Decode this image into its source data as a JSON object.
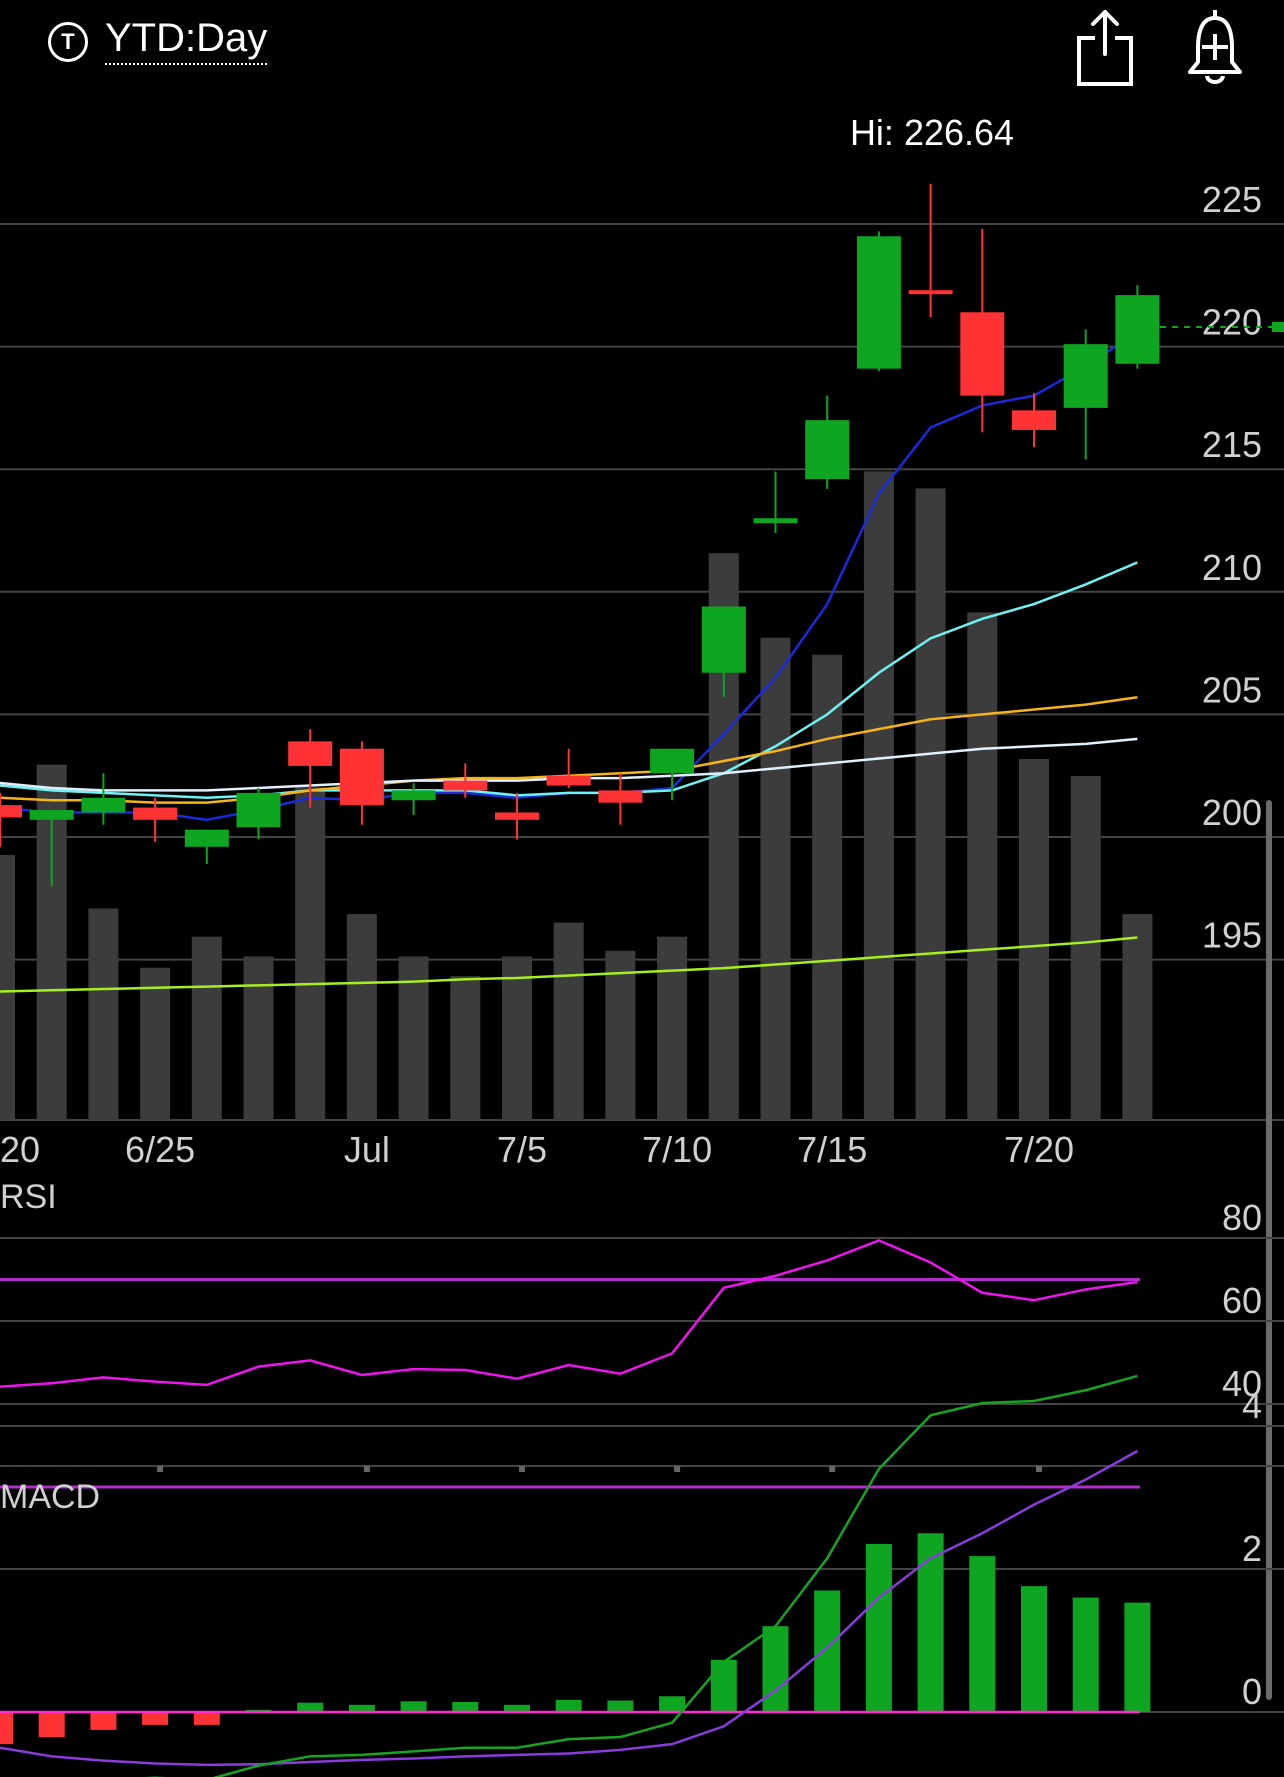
{
  "header": {
    "ticker_icon_letter": "T",
    "range_label": "YTD:Day",
    "share_icon": "share-icon",
    "alert_icon": "bell-plus-icon"
  },
  "chart_data": [
    {
      "type": "candlestick",
      "title": "",
      "annotation": "Hi: 226.64",
      "y_ticks": [
        225,
        220,
        215,
        210,
        205,
        200,
        195
      ],
      "x_ticks": [
        "20",
        "6/25",
        "Jul",
        "7/5",
        "7/10",
        "7/15",
        "7/20"
      ],
      "last_price": 220.8,
      "candles": [
        {
          "o": 201.3,
          "h": 201.8,
          "l": 199.6,
          "c": 200.8,
          "dir": "down"
        },
        {
          "o": 200.7,
          "h": 201.0,
          "l": 198.0,
          "c": 201.1,
          "dir": "up"
        },
        {
          "o": 201.0,
          "h": 202.6,
          "l": 200.5,
          "c": 201.6,
          "dir": "up"
        },
        {
          "o": 201.2,
          "h": 201.6,
          "l": 199.8,
          "c": 200.7,
          "dir": "down"
        },
        {
          "o": 199.6,
          "h": 200.2,
          "l": 198.9,
          "c": 200.3,
          "dir": "up"
        },
        {
          "o": 200.4,
          "h": 202.0,
          "l": 199.9,
          "c": 201.8,
          "dir": "up"
        },
        {
          "o": 203.9,
          "h": 204.4,
          "l": 201.2,
          "c": 202.9,
          "dir": "down"
        },
        {
          "o": 203.6,
          "h": 203.9,
          "l": 200.5,
          "c": 201.3,
          "dir": "down"
        },
        {
          "o": 201.5,
          "h": 202.2,
          "l": 200.9,
          "c": 201.9,
          "dir": "up"
        },
        {
          "o": 202.3,
          "h": 203.0,
          "l": 201.6,
          "c": 201.9,
          "dir": "down"
        },
        {
          "o": 201.0,
          "h": 201.8,
          "l": 199.9,
          "c": 200.7,
          "dir": "down"
        },
        {
          "o": 202.5,
          "h": 203.6,
          "l": 202.0,
          "c": 202.1,
          "dir": "down"
        },
        {
          "o": 201.9,
          "h": 202.6,
          "l": 200.5,
          "c": 201.4,
          "dir": "down"
        },
        {
          "o": 202.6,
          "h": 203.5,
          "l": 201.5,
          "c": 203.6,
          "dir": "up"
        },
        {
          "o": 206.7,
          "h": 208.2,
          "l": 205.7,
          "c": 209.4,
          "dir": "up"
        },
        {
          "o": 212.8,
          "h": 214.9,
          "l": 212.4,
          "c": 213.0,
          "dir": "up"
        },
        {
          "o": 214.6,
          "h": 218.0,
          "l": 214.2,
          "c": 217.0,
          "dir": "up"
        },
        {
          "o": 219.1,
          "h": 224.7,
          "l": 219.0,
          "c": 224.5,
          "dir": "up"
        },
        {
          "o": 222.3,
          "h": 226.64,
          "l": 221.2,
          "c": 222.2,
          "dir": "down"
        },
        {
          "o": 221.4,
          "h": 224.8,
          "l": 216.5,
          "c": 218.0,
          "dir": "down"
        },
        {
          "o": 217.4,
          "h": 218.1,
          "l": 215.9,
          "c": 216.6,
          "dir": "down"
        },
        {
          "o": 217.5,
          "h": 220.7,
          "l": 215.4,
          "c": 220.1,
          "dir": "up"
        },
        {
          "o": 219.3,
          "h": 222.5,
          "l": 219.1,
          "c": 222.1,
          "dir": "up"
        }
      ],
      "volume_relative": [
        0.94,
        1.26,
        0.75,
        0.54,
        0.65,
        0.58,
        1.18,
        0.73,
        0.58,
        0.51,
        0.58,
        0.7,
        0.6,
        0.65,
        2.01,
        1.71,
        1.65,
        2.3,
        2.24,
        1.8,
        1.28,
        1.22,
        0.73
      ],
      "moving_averages": [
        {
          "color": "#1a2bdb",
          "values": [
            201.2,
            201.0,
            201.0,
            201.0,
            200.7,
            201.1,
            201.6,
            201.5,
            201.8,
            201.8,
            201.6,
            201.8,
            201.8,
            202.0,
            204.2,
            206.5,
            209.5,
            214.0,
            216.7,
            217.6,
            218.0,
            219.2,
            220.6
          ]
        },
        {
          "color": "#6ef2f2",
          "values": [
            202.1,
            201.9,
            201.8,
            201.7,
            201.6,
            201.7,
            201.9,
            201.9,
            201.9,
            201.9,
            201.7,
            201.8,
            201.8,
            201.9,
            202.6,
            203.7,
            205.0,
            206.7,
            208.1,
            208.9,
            209.5,
            210.3,
            211.2
          ]
        },
        {
          "color": "#f5b41a",
          "values": [
            201.6,
            201.5,
            201.5,
            201.4,
            201.4,
            201.6,
            201.9,
            202.1,
            202.3,
            202.4,
            202.4,
            202.5,
            202.6,
            202.7,
            203.1,
            203.5,
            204.0,
            204.4,
            204.8,
            205.0,
            205.2,
            205.4,
            205.7
          ]
        },
        {
          "color": "#e0f0ff",
          "values": [
            202.2,
            202.0,
            201.9,
            201.9,
            201.9,
            202.0,
            202.1,
            202.2,
            202.3,
            202.3,
            202.3,
            202.4,
            202.4,
            202.5,
            202.6,
            202.8,
            203.0,
            203.2,
            203.4,
            203.6,
            203.7,
            203.8,
            204.0
          ]
        },
        {
          "color": "#a6ef1c",
          "values": [
            193.7,
            193.75,
            193.8,
            193.85,
            193.9,
            193.95,
            194.0,
            194.05,
            194.1,
            194.2,
            194.25,
            194.35,
            194.45,
            194.55,
            194.65,
            194.8,
            194.95,
            195.1,
            195.25,
            195.4,
            195.55,
            195.7,
            195.9
          ]
        }
      ]
    },
    {
      "type": "line",
      "title": "RSI",
      "y_ticks": [
        80,
        60,
        40
      ],
      "reference_lines": [
        70,
        20
      ],
      "values": [
        44.2,
        45.0,
        46.4,
        45.4,
        44.6,
        49.0,
        50.5,
        47.0,
        48.4,
        48.2,
        46.1,
        49.4,
        47.3,
        52.2,
        68.0,
        70.9,
        74.6,
        79.4,
        74.1,
        66.8,
        65.0,
        67.6,
        69.4
      ]
    },
    {
      "type": "bar+line",
      "title": "MACD",
      "y_ticks": [
        4,
        2,
        0
      ],
      "histogram": [
        -0.45,
        -0.35,
        -0.25,
        -0.18,
        -0.18,
        0.03,
        0.13,
        0.1,
        0.15,
        0.14,
        0.1,
        0.17,
        0.16,
        0.22,
        0.73,
        1.2,
        1.7,
        2.35,
        2.5,
        2.18,
        1.76,
        1.6,
        1.53
      ],
      "macd": [
        -0.95,
        -0.98,
        -0.95,
        -0.92,
        -0.95,
        -0.75,
        -0.62,
        -0.6,
        -0.55,
        -0.5,
        -0.5,
        -0.38,
        -0.35,
        -0.15,
        0.7,
        1.2,
        2.15,
        3.4,
        4.15,
        4.32,
        4.35,
        4.5,
        4.7
      ],
      "signal": [
        -0.5,
        -0.62,
        -0.68,
        -0.72,
        -0.74,
        -0.73,
        -0.7,
        -0.67,
        -0.65,
        -0.62,
        -0.6,
        -0.58,
        -0.53,
        -0.45,
        -0.2,
        0.3,
        0.9,
        1.6,
        2.15,
        2.5,
        2.9,
        3.25,
        3.65
      ]
    }
  ],
  "colors": {
    "up": "#0ea520",
    "down": "#ff3333",
    "grid": "#444444",
    "volume": "#3c3c3c",
    "rsi_line": "#ee14ee",
    "rsi_ref": "#b12dcc",
    "macd_line": "#16a421",
    "signal_line": "#8a3bdc",
    "macd_zero": "#ff2dd1",
    "axis_text": "#d0d0d0"
  }
}
